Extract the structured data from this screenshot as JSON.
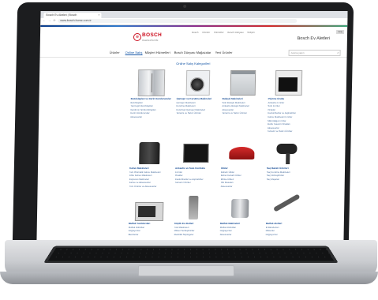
{
  "browser": {
    "tab_title": "Bosch Ev Aletleri | Bosch",
    "tab_close": "×",
    "nav_icons": "← → ⟳",
    "url": "www.bosch-home.com.tr"
  },
  "header": {
    "logo": "BOSCH",
    "tagline": "Invented for life",
    "top_links": [
      "Bosch",
      "Ürünler",
      "Hizmetler",
      "Bosch Dünyası",
      "İletişim"
    ],
    "brand": "Bosch Ev Aletleri",
    "top_button": "Giriş"
  },
  "menu": {
    "items": [
      "Ürünler",
      "Online Satış",
      "Müşteri Hizmetleri",
      "Bosch Dünyası",
      "Mağazalar",
      "Yeni Ürünler"
    ],
    "active_index": 1,
    "search_placeholder": "Arama yapın",
    "search_icon": "search-icon"
  },
  "page": {
    "section_title": "Online Satış Kategorileri"
  },
  "products": [
    {
      "title": "Buzdolapları ve Derin Dondurucular",
      "items": [
        "Buzdolapları",
        "Tek Kapılı Buzdolapları",
        "Gardırop Tipi Buzdolapları",
        "Derin Dondurucular",
        "Aksesuarlar"
      ],
      "shape": "fridge"
    },
    {
      "title": "Çamaşır ve Kurutma Makineleri",
      "items": [
        "Çamaşır Makineleri",
        "Kurutma Makineleri",
        "Kurutmalı Çamaşır Makineleri",
        "Tamamı ve Satıcı Ürünler"
      ],
      "shape": "washer"
    },
    {
      "title": "Bulaşık Makineleri",
      "items": [
        "Solo Bulaşık Makineleri",
        "Ankastre Bulaşık Makineleri",
        "Aksesuarlar",
        "Tamamı ve Satıcı Ürünler"
      ],
      "shape": "dish"
    },
    {
      "title": "Pişirme Grubu",
      "items": [
        "Ankastre Fırınlar",
        "Solo Fırınlar",
        "Ocaklar",
        "Davlumbazlar ve Aspiratörler",
        "Kahve Makineleri Fırınlar",
        "Mikrodalga Fırınlar",
        "Buzlu Tasarım Ocakları",
        "Aksesuarlar",
        "Tamamı ve Satıcı Ürünler"
      ],
      "shape": "oven"
    },
    {
      "title": "Kahve Makineleri",
      "items": [
        "Tam Otomatik Kahve Makineleri",
        "Filtre Kahve Makineleri",
        "Espresso Makineleri",
        "Kahve ve Aksesuarlar",
        "Tüm Ürünler ve Aksesuarlar"
      ],
      "shape": "coffee"
    },
    {
      "title": "Ankastre ve Solo Kombine",
      "items": [
        "Fırınlar",
        "Ocaklar",
        "Davlumbazlar ve Aspiratörler",
        "Tamamı Ürünler"
      ],
      "shape": "builtin"
    },
    {
      "title": "Ütüler",
      "items": [
        "Buharlı Ütüler",
        "Buhar Kazanlı Ütüler",
        "Elbise Ütüleri",
        "Ütü Masaları",
        "Aksesuarlar"
      ],
      "shape": "iron"
    },
    {
      "title": "Saç Bakım Ürünleri",
      "items": [
        "Saç Kurutma Makineleri",
        "Saç Düzleştiriciler",
        "Saç Maşaları"
      ],
      "shape": "dryer"
    },
    {
      "title": "Mutfak Yardımcıları",
      "items": [
        "Mutfak Robotları",
        "Doğrayıcılar",
        "Blenderlar"
      ],
      "shape": "micro"
    },
    {
      "title": "Küçük Ev Aletleri",
      "items": [
        "Tost Makineleri",
        "Mikser Sertleştiriciler",
        "Elektrikli Süpürgeler"
      ],
      "shape": "vac"
    },
    {
      "title": "Mutfak Makineleri",
      "items": [
        "Mutfak Robotları",
        "Doğrayıcılar",
        "Aksesuarlar"
      ],
      "shape": "mixer"
    },
    {
      "title": "Mutfak Aletleri",
      "items": [
        "El Blenderları",
        "Mikserler",
        "Doğrayıcılar"
      ],
      "shape": "blender"
    }
  ]
}
